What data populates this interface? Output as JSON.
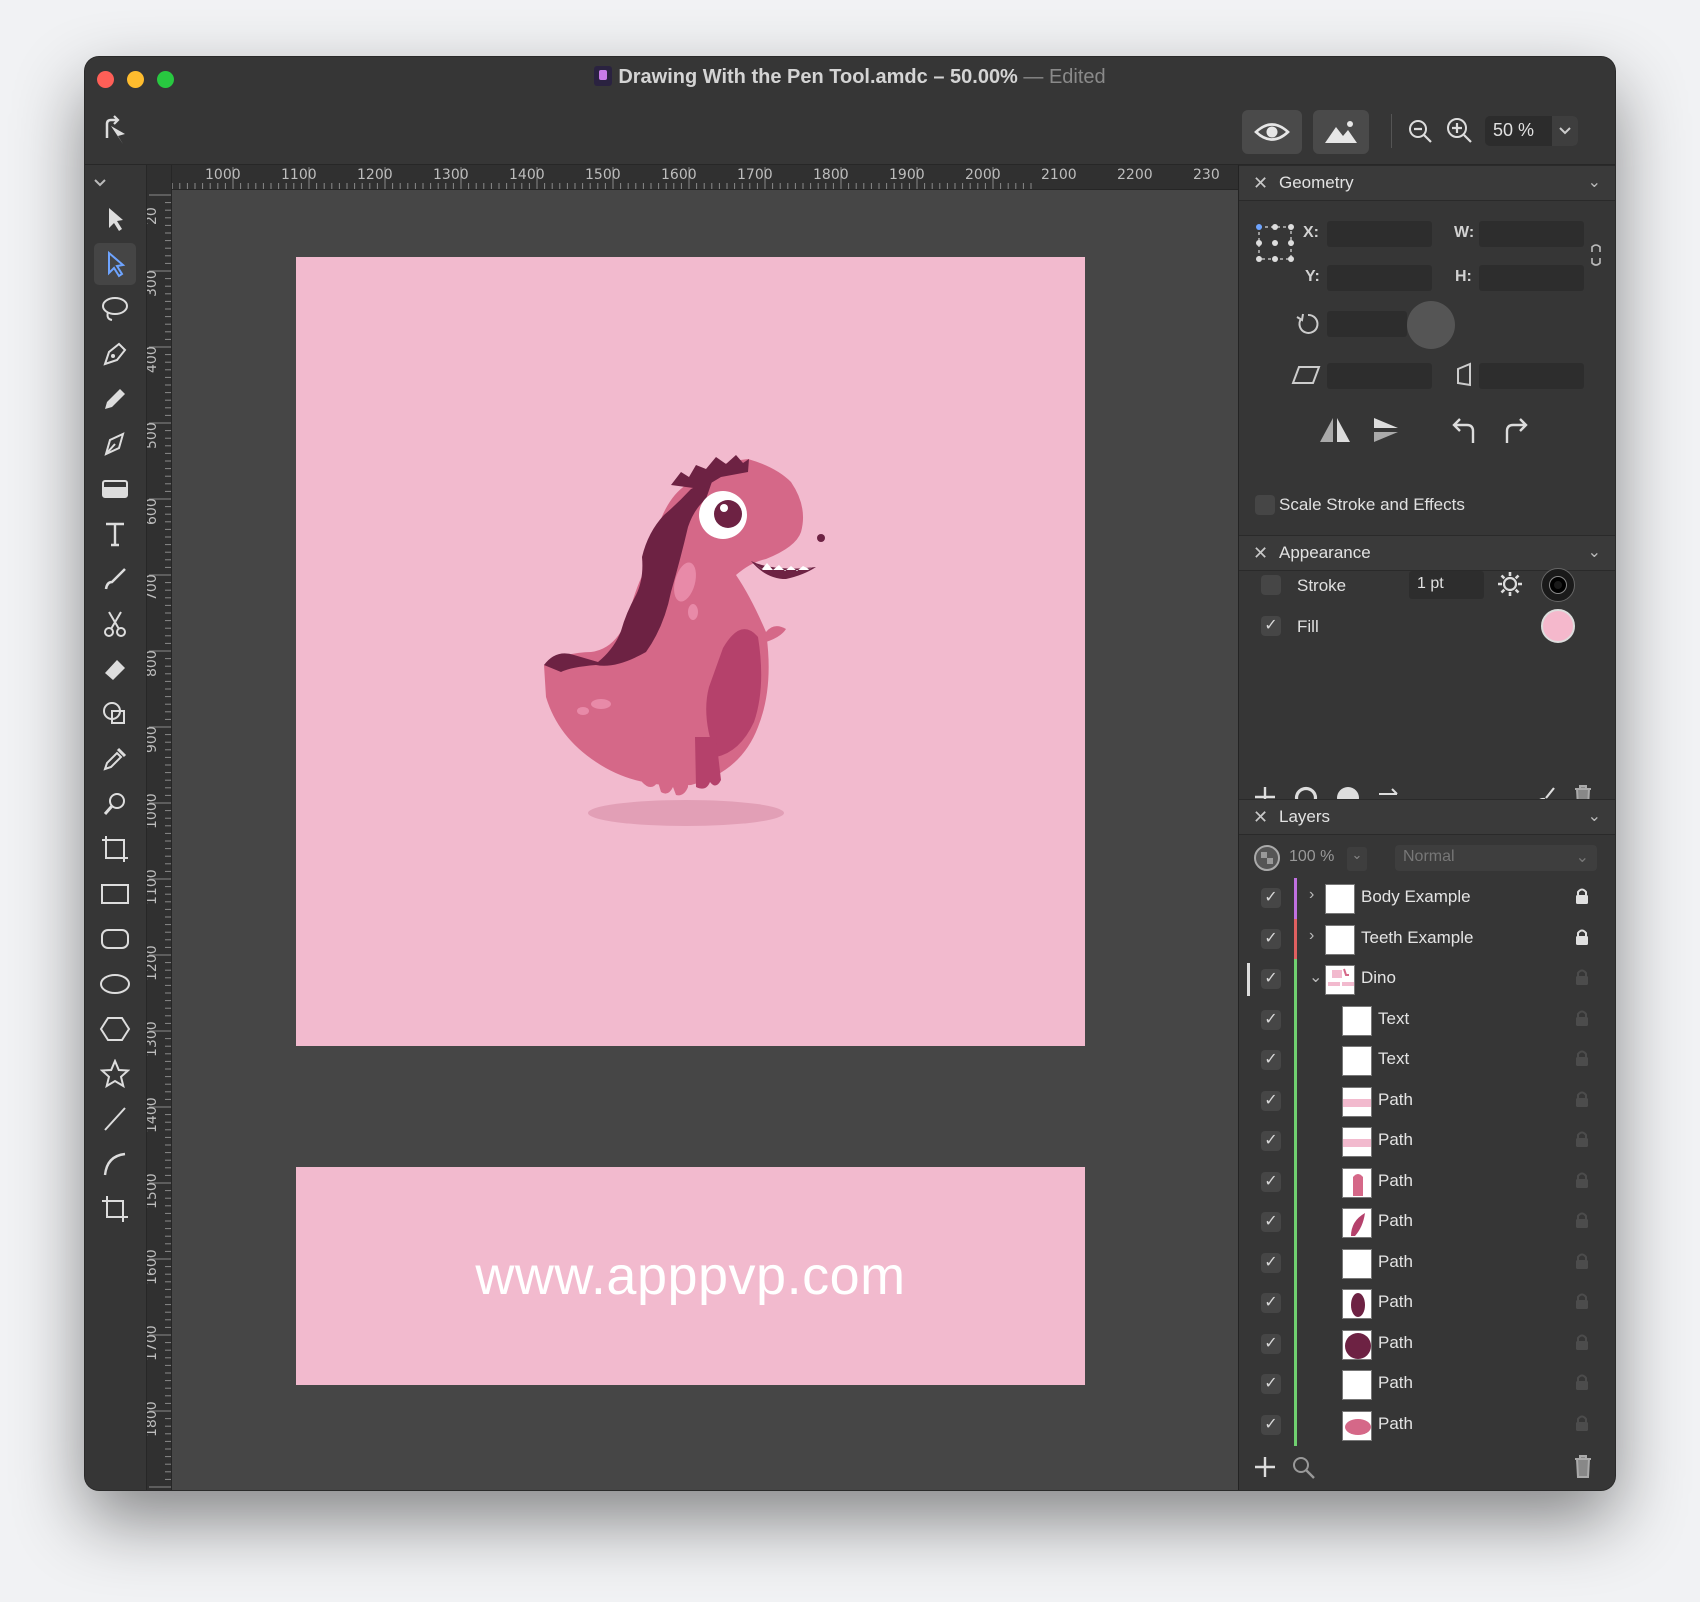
{
  "window": {
    "title": "Drawing With the Pen Tool.amdc – 50.00%",
    "edited": "— Edited"
  },
  "toolbar": {
    "zoom": "50 %"
  },
  "rulers": {
    "unit": "px",
    "h_ticks": [
      "1000",
      "1100",
      "1200",
      "1300",
      "1400",
      "1500",
      "1600",
      "1700",
      "1800",
      "1900",
      "2000",
      "2100",
      "2200",
      "230"
    ],
    "v_ticks": [
      "20",
      "300",
      "400",
      "500",
      "600",
      "700",
      "800",
      "900",
      "1000",
      "1100",
      "1200",
      "1300",
      "1400",
      "1500",
      "1600",
      "1700",
      "1800",
      "00"
    ]
  },
  "canvas": {
    "url_text": "www.apppvp.com",
    "artboard_color": "#f2bace"
  },
  "geometry": {
    "title": "Geometry",
    "x_label": "X:",
    "y_label": "Y:",
    "w_label": "W:",
    "h_label": "H:",
    "scale_label": "Scale Stroke and Effects"
  },
  "appearance": {
    "title": "Appearance",
    "stroke_label": "Stroke",
    "stroke_width": "1 pt",
    "fill_label": "Fill",
    "stroke_checked": false,
    "fill_checked": true,
    "fill_color": "#f5b8cc"
  },
  "layers": {
    "title": "Layers",
    "opacity": "100 %",
    "blend": "Normal",
    "items": [
      {
        "name": "Body Example",
        "level": 0,
        "expand": "›",
        "locked": true,
        "bar": "#c070e0",
        "thumb": "blank"
      },
      {
        "name": "Teeth Example",
        "level": 0,
        "expand": "›",
        "locked": true,
        "bar": "#e06060",
        "thumb": "blank"
      },
      {
        "name": "Dino",
        "level": 0,
        "expand": "⌄",
        "locked": false,
        "bar": "#70d070",
        "thumb": "dino"
      },
      {
        "name": "Text",
        "level": 1,
        "locked": false,
        "bar": "#70d070",
        "thumb": "blank"
      },
      {
        "name": "Text",
        "level": 1,
        "locked": false,
        "bar": "#70d070",
        "thumb": "blank"
      },
      {
        "name": "Path",
        "level": 1,
        "locked": false,
        "bar": "#70d070",
        "thumb": "stripe"
      },
      {
        "name": "Path",
        "level": 1,
        "locked": false,
        "bar": "#70d070",
        "thumb": "stripe"
      },
      {
        "name": "Path",
        "level": 1,
        "locked": false,
        "bar": "#70d070",
        "thumb": "leg"
      },
      {
        "name": "Path",
        "level": 1,
        "locked": false,
        "bar": "#70d070",
        "thumb": "arm"
      },
      {
        "name": "Path",
        "level": 1,
        "locked": false,
        "bar": "#70d070",
        "thumb": "blank"
      },
      {
        "name": "Path",
        "level": 1,
        "locked": false,
        "bar": "#70d070",
        "thumb": "ovaldark"
      },
      {
        "name": "Path",
        "level": 1,
        "locked": false,
        "bar": "#70d070",
        "thumb": "circledark"
      },
      {
        "name": "Path",
        "level": 1,
        "locked": false,
        "bar": "#70d070",
        "thumb": "blank"
      },
      {
        "name": "Path",
        "level": 1,
        "locked": false,
        "bar": "#70d070",
        "thumb": "ovalpink"
      }
    ]
  }
}
